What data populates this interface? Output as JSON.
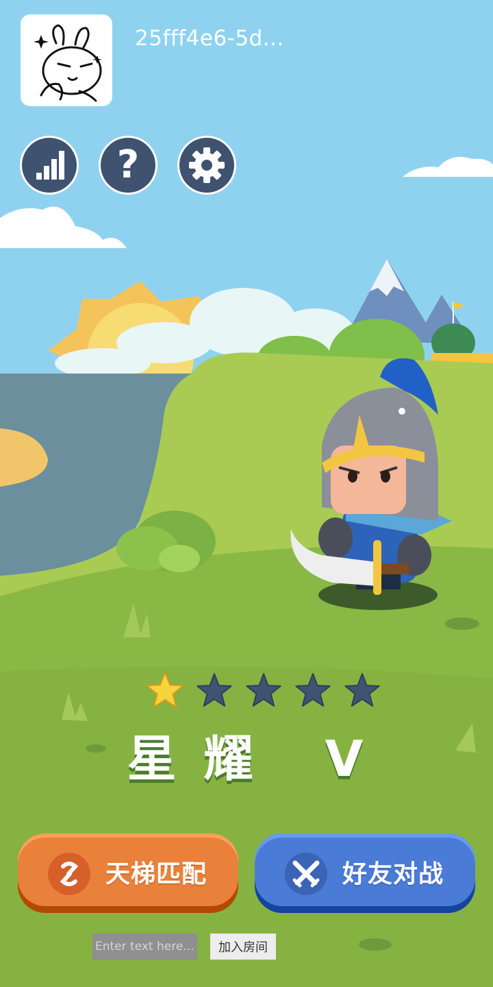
{
  "user": {
    "name": "25fff4e6-5d...",
    "avatar_icon": "rabbit-avatar-icon"
  },
  "toolbar": {
    "buttons": [
      {
        "icon": "leaderboard-icon"
      },
      {
        "icon": "help-icon",
        "glyph": "?"
      },
      {
        "icon": "gear-icon"
      }
    ]
  },
  "rank": {
    "title": "星耀 V",
    "stars_filled": 1,
    "stars_total": 5
  },
  "actions": {
    "ladder_match": {
      "label": "天梯匹配",
      "icon": "swirl-icon",
      "color": "#e9813a"
    },
    "friend_battle": {
      "label": "好友对战",
      "icon": "crossed-swords-icon",
      "color": "#4a7bd6"
    }
  },
  "room": {
    "input_placeholder": "Enter text here...",
    "join_label": "加入房间"
  },
  "colors": {
    "sky": "#8fd2f0",
    "grass": "#8ab845",
    "toolbar_button": "#3f526f",
    "star_filled": "#f7d43c",
    "star_empty": "#3f5473"
  }
}
